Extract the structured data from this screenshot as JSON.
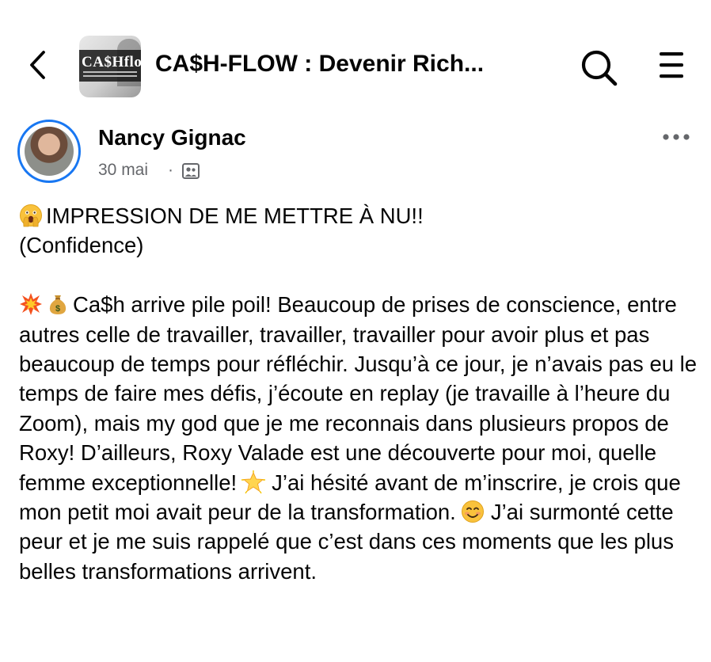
{
  "header": {
    "back_icon": "chevron-left-icon",
    "group_thumbnail_text": "CA$Hflow",
    "group_title": "CA$H-FLOW : Devenir Rich...",
    "search_icon": "search-icon",
    "menu_icon": "hamburger-menu-icon"
  },
  "post": {
    "author": "Nancy Gignac",
    "date": "30 mai",
    "separator": "·",
    "audience_icon": "group-members-icon",
    "more_icon": "more-horizontal-icon",
    "title_line": "IMPRESSION DE ME METTRE À NU!!",
    "subtitle_line": "(Confidence)",
    "body_part1": "Ca$h arrive pile poil! Beaucoup de prises de conscience, entre autres celle de travailler, travailler, travailler pour avoir plus et pas beaucoup de temps pour réfléchir. Jusqu’à ce jour, je n’avais pas eu le temps de faire mes défis, j’écoute en replay (je travaille à l’heure du Zoom), mais my god que je me reconnais dans plusieurs propos de Roxy! D’ailleurs, Roxy Valade est une découverte pour moi, quelle femme exceptionnelle!",
    "body_part2": "J’ai hésité avant de m’inscrire, je crois que mon petit moi avait peur de la transformation.",
    "body_part3": "J’ai surmonté cette peur et je me suis rappelé que c’est dans ces moments que les plus belles transformations arrivent.",
    "emojis": [
      "face-with-open-eyes-and-hand-over-mouth",
      "collision",
      "money-bag",
      "glowing-star",
      "smiling-face-with-smiling-eyes"
    ]
  },
  "colors": {
    "accent": "#1877f2",
    "secondary_text": "#65676b",
    "text": "#050505"
  }
}
